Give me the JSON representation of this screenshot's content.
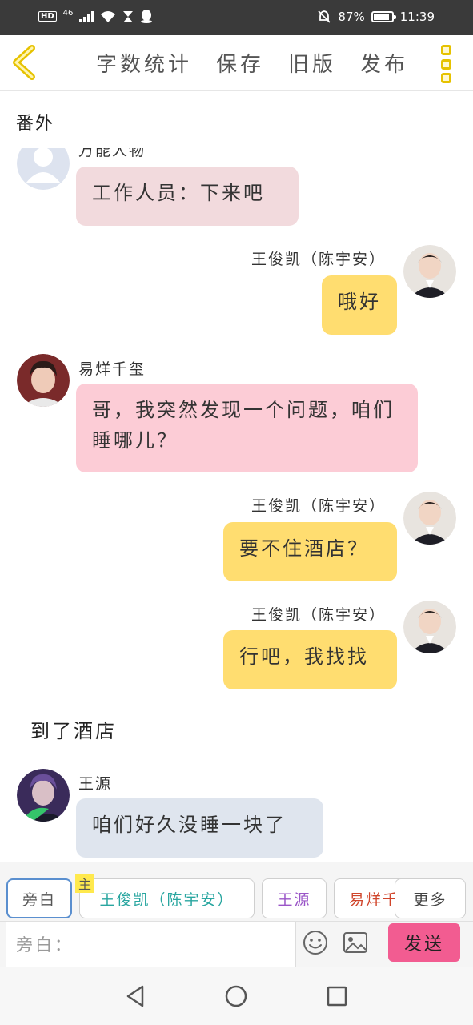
{
  "status_bar": {
    "hd": "HD",
    "network": "46",
    "battery": "87%",
    "time": "11:39"
  },
  "header": {
    "menu": [
      "字数统计",
      "保存",
      "旧版",
      "发布"
    ]
  },
  "title": "番外",
  "chat": {
    "partial_name": "万能人物",
    "messages": [
      {
        "side": "left",
        "name": "",
        "text": "工作人员：下来吧"
      },
      {
        "side": "right",
        "name": "王俊凯（陈宇安）",
        "text": "哦好"
      },
      {
        "side": "left",
        "name": "易烊千玺",
        "text": "哥，我突然发现一个问题，咱们睡哪儿？"
      },
      {
        "side": "right",
        "name": "王俊凯（陈宇安）",
        "text": "要不住酒店？"
      },
      {
        "side": "right",
        "name": "王俊凯（陈宇安）",
        "text": "行吧，我找找"
      },
      {
        "side": "left",
        "name": "王源",
        "text": "咱们好久没睡一块了"
      }
    ],
    "narration": "到了酒店"
  },
  "characters": {
    "narrator": "旁白",
    "main_tag": "主",
    "main": "王俊凯（陈宇安）",
    "c2": "王源",
    "c3": "易烊千玺",
    "more": "更多"
  },
  "input": {
    "placeholder": "旁白：",
    "send": "发送"
  },
  "colors": {
    "bubble_pink_light": "#f2dadd",
    "bubble_pink": "#fcccd6",
    "bubble_yellow": "#ffdd70",
    "bubble_blue_grey": "#dfe5ee",
    "send_button": "#f25c91",
    "accent_yellow": "#e6c200"
  }
}
